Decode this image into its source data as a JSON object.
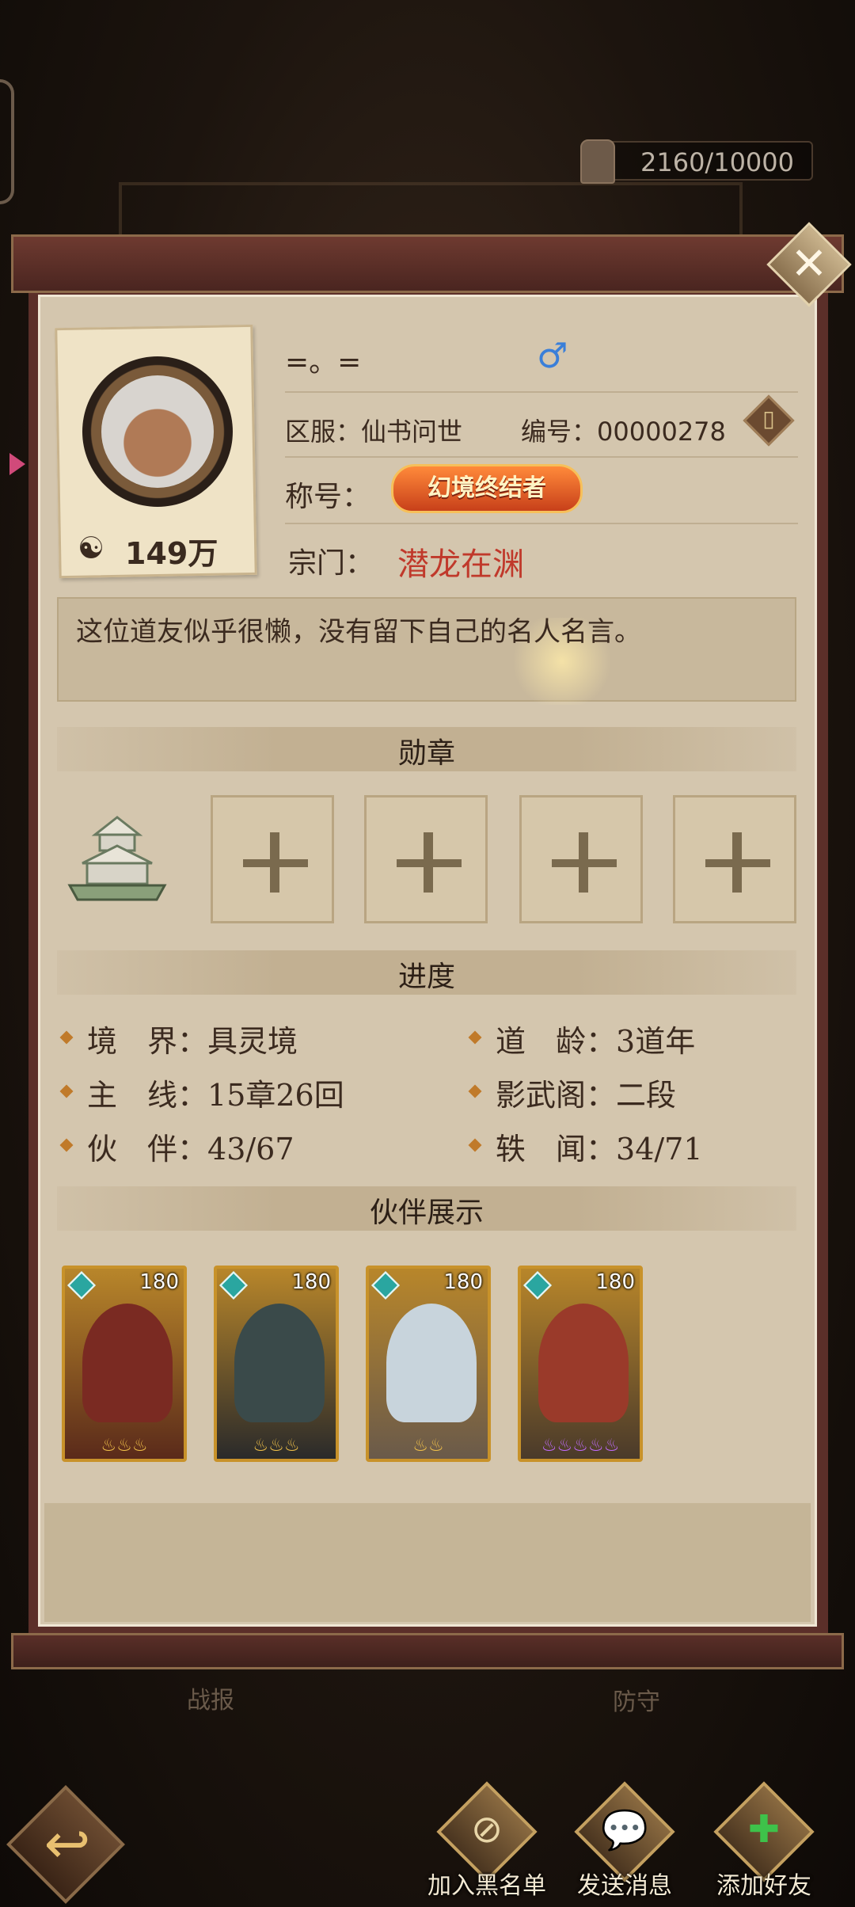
{
  "background": {
    "tab_left": "战报",
    "tab_right": "防守",
    "counter": "2160/10000"
  },
  "profile": {
    "name": "=。=",
    "gender_symbol": "♂",
    "power": "149万",
    "server_label": "区服：",
    "server_value": "仙书问世",
    "id_label": "编号：",
    "id_value": "00000278",
    "title_label": "称号：",
    "title_value": "幻境终结者",
    "sect_label": "宗门：",
    "sect_value": "潜龙在渊",
    "motto": "这位道友似乎很懒，没有留下自己的名人名言。"
  },
  "sections": {
    "medals": "勋章",
    "progress": "进度",
    "partners": "伙伴展示"
  },
  "progress": {
    "left": [
      {
        "label": "境　界：",
        "value": "具灵境"
      },
      {
        "label": "主　线：",
        "value": "15章26回"
      },
      {
        "label": "伙　伴：",
        "value": "43/67"
      }
    ],
    "right": [
      {
        "label": "道　龄：",
        "value": "3道年"
      },
      {
        "label": "影武阁：",
        "value": "二段"
      },
      {
        "label": "轶　闻：",
        "value": "34/71"
      }
    ]
  },
  "partners": [
    {
      "level": "180",
      "stars": "♨♨♨",
      "star_color": "gold",
      "color": "#7a2a22"
    },
    {
      "level": "180",
      "stars": "♨♨♨",
      "star_color": "gold",
      "color": "#3a4a4a"
    },
    {
      "level": "180",
      "stars": "♨♨",
      "star_color": "gold",
      "color": "#c8d4dc"
    },
    {
      "level": "180",
      "stars": "♨♨♨♨♨",
      "star_color": "purple",
      "color": "#9a3a2a"
    }
  ],
  "actions": {
    "blacklist": "加入黑名单",
    "send_message": "发送消息",
    "add_friend": "添加好友"
  },
  "icons": {
    "close": "close-icon",
    "back": "back-arrow-icon",
    "copy": "copy-icon",
    "medal_emblem": "pagoda-icon"
  }
}
